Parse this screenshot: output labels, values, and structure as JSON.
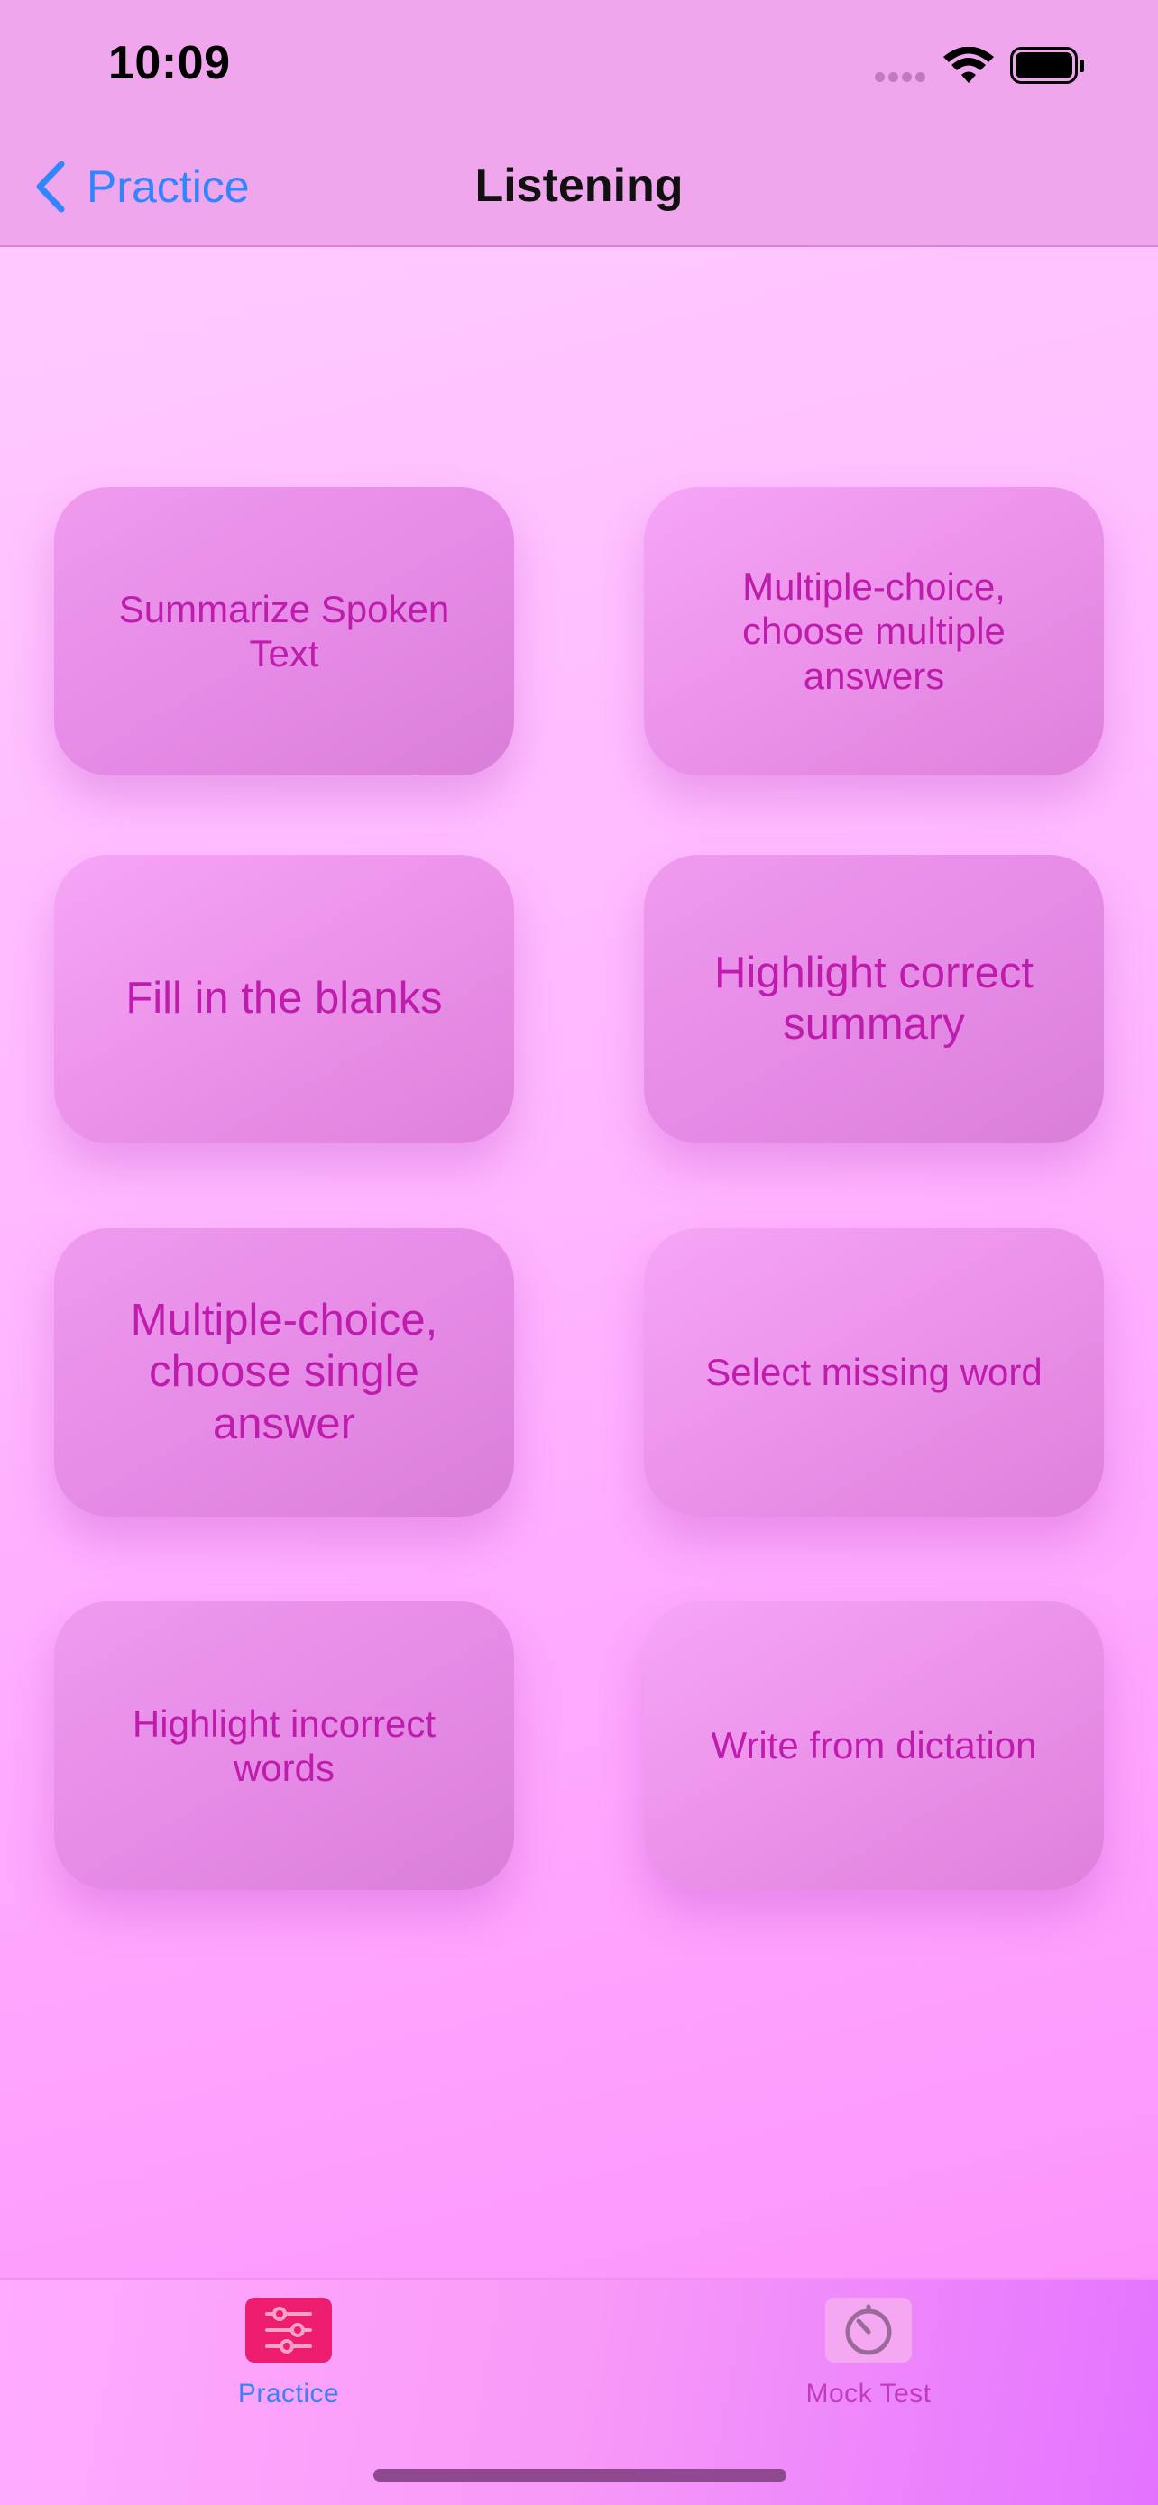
{
  "status_bar": {
    "time": "10:09"
  },
  "nav": {
    "back_label": "Practice",
    "title": "Listening"
  },
  "cards": [
    {
      "label": "Summarize Spoken Text"
    },
    {
      "label": "Multiple-choice, choose multiple answers"
    },
    {
      "label": "Fill in the blanks"
    },
    {
      "label": "Highlight correct summary"
    },
    {
      "label": "Multiple-choice, choose single answer"
    },
    {
      "label": "Select missing word"
    },
    {
      "label": "Highlight incorrect words"
    },
    {
      "label": "Write from dictation"
    }
  ],
  "tabbar": {
    "tabs": [
      {
        "label": "Practice",
        "icon": "sliders-icon",
        "selected": true
      },
      {
        "label": "Mock Test",
        "icon": "timer-icon",
        "selected": false
      }
    ]
  },
  "colors": {
    "accent_blue": "#2f86ff",
    "card_text": "#bf1cae",
    "selected_tab_icon": "#ee1d70"
  }
}
